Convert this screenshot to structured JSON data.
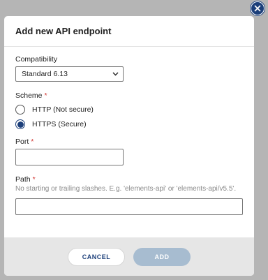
{
  "dialog": {
    "title": "Add new API endpoint",
    "close_icon": "close-icon"
  },
  "compatibility": {
    "label": "Compatibility",
    "selected": "Standard 6.13",
    "chevron_icon": "chevron-down-icon"
  },
  "scheme": {
    "label": "Scheme",
    "required_marker": "*",
    "options": [
      {
        "label": "HTTP (Not secure)",
        "checked": false
      },
      {
        "label": "HTTPS (Secure)",
        "checked": true
      }
    ]
  },
  "port": {
    "label": "Port",
    "required_marker": "*",
    "value": ""
  },
  "path": {
    "label": "Path",
    "required_marker": "*",
    "help": "No starting or trailing slashes. E.g. 'elements-api' or 'elements-api/v5.5'.",
    "value": ""
  },
  "footer": {
    "cancel_label": "CANCEL",
    "add_label": "ADD"
  },
  "colors": {
    "accent": "#1c3f7a",
    "required": "#d0312d",
    "add_disabled": "#a7bcd0",
    "overlay": "#b5b5b5"
  }
}
